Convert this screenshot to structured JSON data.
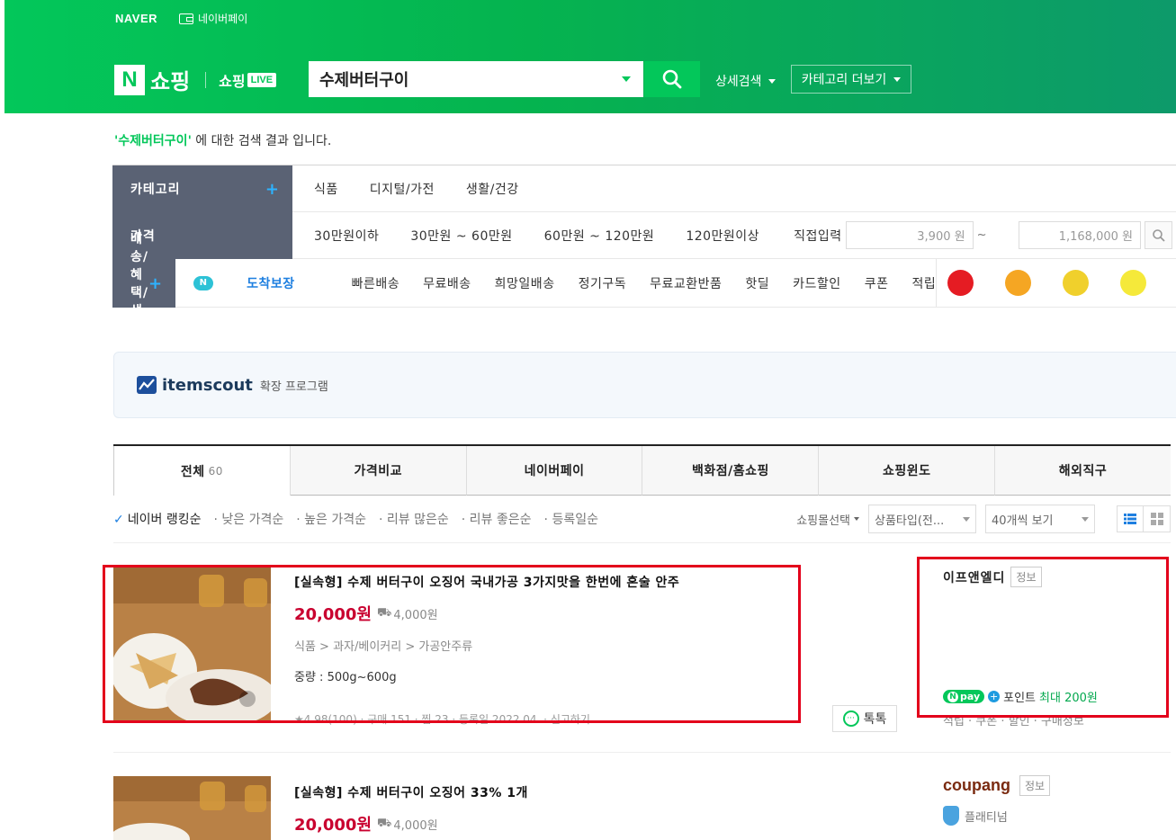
{
  "header": {
    "naver": "NAVER",
    "naverpay": "네이버페이",
    "shopping": "쇼핑",
    "shopping_live": "쇼핑",
    "live_badge": "LIVE",
    "search_value": "수제버터구이",
    "advanced_search": "상세검색",
    "category_more": "카테고리 더보기"
  },
  "result_line": {
    "keyword": "'수제버터구이'",
    "suffix": " 에 대한 검색 결과 입니다."
  },
  "filters": {
    "category": {
      "label": "카테고리",
      "options": [
        "식품",
        "디지털/가전",
        "생활/건강"
      ]
    },
    "price": {
      "label": "가격",
      "options": [
        "30만원이하",
        "30만원 ~ 60만원",
        "60만원 ~ 120만원",
        "120만원이상"
      ],
      "direct": "직접입력",
      "min": "3,900 원",
      "max": "1,168,000 원"
    },
    "delivery": {
      "label": "배송/혜택/색상",
      "badge": "도착보장",
      "options": [
        "빠른배송",
        "무료배송",
        "희망일배송",
        "정기구독",
        "무료교환반품",
        "핫딜",
        "카드할인",
        "쿠폰",
        "적립"
      ]
    },
    "colors": [
      "#e51c23",
      "#f5a623",
      "#f0d02c",
      "#f5e93a"
    ]
  },
  "itemscout": {
    "name": "itemscout",
    "sub": "확장 프로그램"
  },
  "tabs": [
    {
      "label": "전체",
      "count": "60"
    },
    {
      "label": "가격비교"
    },
    {
      "label": "네이버페이"
    },
    {
      "label": "백화점/홈쇼핑"
    },
    {
      "label": "쇼핑윈도"
    },
    {
      "label": "해외직구"
    }
  ],
  "sort": {
    "options": [
      "네이버 랭킹순",
      "낮은 가격순",
      "높은 가격순",
      "리뷰 많은순",
      "리뷰 좋은순",
      "등록일순"
    ],
    "mall_select": "쇼핑몰선택",
    "product_type": "상품타입(전...",
    "per_page": "40개씩 보기"
  },
  "products": [
    {
      "title": "[실속형] 수제 버터구이 오징어 국내가공 3가지맛을 한번에 혼술 안주",
      "price": "20,000원",
      "shipping": "4,000원",
      "category": "식품 > 과자/베이커리 > 가공안주류",
      "spec": "중량 : 500g~600g",
      "meta": "★4.98(100) · 구매 151 · 찜 23 · 등록일 2022.04. · 신고하기",
      "talk": "톡톡",
      "seller": "이프앤엘디",
      "info": "정보",
      "npay": "pay",
      "point_label": "포인트",
      "point_value": "최대 200원",
      "seller_links": "적립 · 쿠폰 · 할인 · 구매정보"
    },
    {
      "title": "[실속형] 수제 버터구이 오징어 33% 1개",
      "price": "20,000원",
      "shipping": "4,000원",
      "seller": "coupang",
      "info": "정보",
      "grade": "플래티넘"
    }
  ]
}
